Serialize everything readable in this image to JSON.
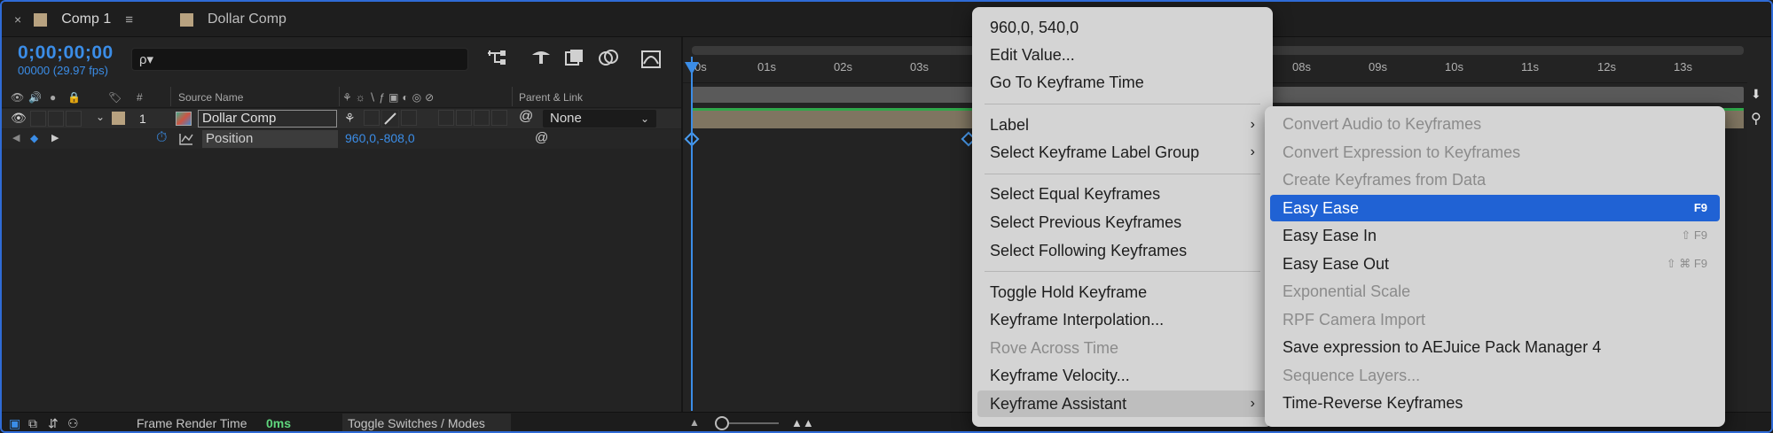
{
  "tabs": [
    {
      "label": "Comp 1",
      "close": "×",
      "menu": "≡",
      "active": true
    },
    {
      "label": "Dollar Comp",
      "active": false
    }
  ],
  "timecode": {
    "value": "0;00;00;00",
    "sub": "00000 (29.97 fps)"
  },
  "search": {
    "icon": "ρ▾"
  },
  "columns": {
    "hash": "#",
    "source_name": "Source Name",
    "parent_link": "Parent & Link"
  },
  "layer": {
    "index": "1",
    "name": "Dollar Comp",
    "parent": "None"
  },
  "property": {
    "name": "Position",
    "value": "960,0,-808,0"
  },
  "ruler": [
    "0s",
    "01s",
    "02s",
    "03s",
    "08s",
    "09s",
    "10s",
    "11s",
    "12s",
    "13s"
  ],
  "status": {
    "frame_render_label": "Frame Render Time",
    "frame_render_value": "0ms",
    "toggle": "Toggle Switches / Modes"
  },
  "context_menu": {
    "items": [
      {
        "label": "960,0, 540,0",
        "disabled": false
      },
      {
        "label": "Edit Value...",
        "disabled": false
      },
      {
        "label": "Go To Keyframe Time",
        "disabled": false
      },
      {
        "label": "Label",
        "disabled": false,
        "submenu": true
      },
      {
        "label": "Select Keyframe Label Group",
        "disabled": false,
        "submenu": true
      },
      {
        "label": "Select Equal Keyframes",
        "disabled": false
      },
      {
        "label": "Select Previous Keyframes",
        "disabled": false
      },
      {
        "label": "Select Following Keyframes",
        "disabled": false
      },
      {
        "label": "Toggle Hold Keyframe",
        "disabled": false
      },
      {
        "label": "Keyframe Interpolation...",
        "disabled": false
      },
      {
        "label": "Rove Across Time",
        "disabled": true
      },
      {
        "label": "Keyframe Velocity...",
        "disabled": false
      },
      {
        "label": "Keyframe Assistant",
        "disabled": false,
        "submenu": true,
        "open": true
      }
    ],
    "arrow": "›"
  },
  "submenu": {
    "items": [
      {
        "label": "Convert Audio to Keyframes",
        "disabled": true,
        "shortcut": ""
      },
      {
        "label": "Convert Expression to Keyframes",
        "disabled": true,
        "shortcut": ""
      },
      {
        "label": "Create Keyframes from Data",
        "disabled": true,
        "shortcut": ""
      },
      {
        "label": "Easy Ease",
        "disabled": false,
        "shortcut": "F9",
        "highlighted": true
      },
      {
        "label": "Easy Ease In",
        "disabled": false,
        "shortcut": "⇧ F9"
      },
      {
        "label": "Easy Ease Out",
        "disabled": false,
        "shortcut": "⇧ ⌘ F9"
      },
      {
        "label": "Exponential Scale",
        "disabled": true,
        "shortcut": ""
      },
      {
        "label": "RPF Camera Import",
        "disabled": true,
        "shortcut": ""
      },
      {
        "label": "Save expression to AEJuice Pack Manager 4",
        "disabled": false,
        "shortcut": ""
      },
      {
        "label": "Sequence Layers...",
        "disabled": true,
        "shortcut": ""
      },
      {
        "label": "Time-Reverse Keyframes",
        "disabled": false,
        "shortcut": ""
      }
    ]
  },
  "colors": {
    "accent": "#3b8de7",
    "highlight": "#2062d4",
    "layer_bar": "#7f7561",
    "label_green": "#2fa84a"
  }
}
